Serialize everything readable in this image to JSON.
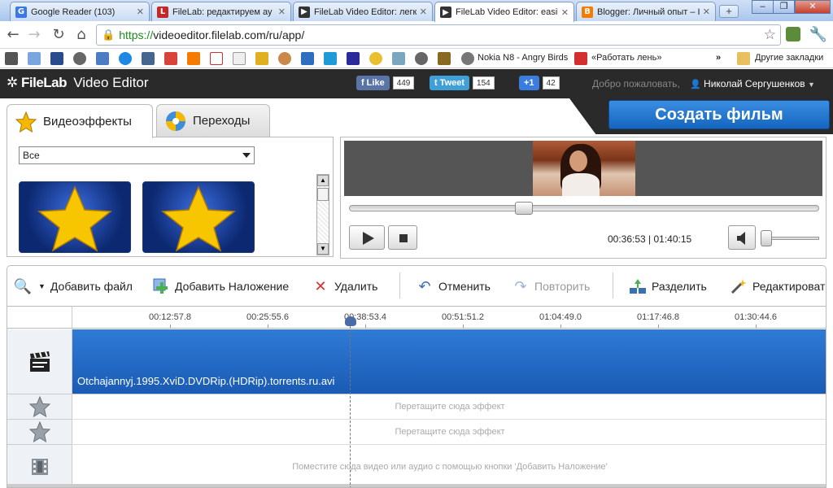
{
  "browser": {
    "tabs": [
      {
        "label": "Google Reader (103)",
        "icon": "google-reader-icon",
        "color": "#3b78e7",
        "glyph": "G"
      },
      {
        "label": "FileLab: редактируем ау",
        "icon": "filelab-icon",
        "color": "#c62828",
        "glyph": "L"
      },
      {
        "label": "FileLab Video Editor: легко",
        "icon": "filelab-video-icon",
        "color": "#333333",
        "glyph": "▶"
      },
      {
        "label": "FileLab Video Editor: easily",
        "icon": "filelab-video-icon",
        "color": "#333333",
        "glyph": "▶"
      },
      {
        "label": "Blogger: Личный опыт – I",
        "icon": "blogger-icon",
        "color": "#f57c00",
        "glyph": "B"
      }
    ],
    "address": {
      "scheme": "https://",
      "host": "videoeditor.filelab.com",
      "path": "/ru/app/"
    },
    "bookmarks": {
      "nokia_label": "Nokia N8 - Angry Birds",
      "rabotat_label": "«Работать лень»",
      "other_label": "Другие закладки"
    }
  },
  "app": {
    "logo": "FileLab",
    "logo_sub": "Video Editor",
    "social": {
      "like_label": "Like",
      "like_count": "449",
      "tweet_label": "Tweet",
      "tweet_count": "154",
      "plusone_label": "+1",
      "plusone_count": "42"
    },
    "welcome": "Добро пожаловать,",
    "user_name": "Николай Сергушенков",
    "create_button": "Создать фильм"
  },
  "effects": {
    "tab_effects": "Видеоэффекты",
    "tab_transitions": "Переходы",
    "filter_selected": "Все"
  },
  "preview": {
    "timecode": "00:36:53 | 01:40:15",
    "position_fraction": 0.368,
    "volume_fraction": 0.06
  },
  "toolbar": {
    "add_file": "Добавить файл",
    "add_overlay": "Добавить Наложение",
    "delete": "Удалить",
    "undo": "Отменить",
    "redo": "Повторить",
    "split": "Разделить",
    "edit": "Редактировать"
  },
  "timeline": {
    "ticks": [
      "00:12:57.8",
      "00:25:55.6",
      "00:38:53.4",
      "00:51:51.2",
      "01:04:49.0",
      "01:17:46.8",
      "01:30:44.6"
    ],
    "clip_name": "Otchajannyj.1995.XviD.DVDRip.(HDRip).torrents.ru.avi",
    "effect_drop_hint": "Перетащите сюда эффект",
    "overlay_drop_hint": "Поместите сюда видео или аудио с помощью кнопки 'Добавить Наложение'"
  }
}
